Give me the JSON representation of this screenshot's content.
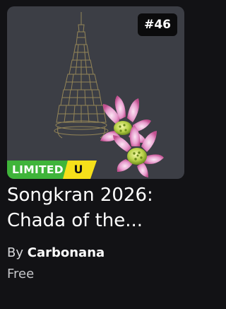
{
  "item": {
    "serial": "#46",
    "limited_label": "LIMITED",
    "limited_type": "U",
    "title": "Songkran 2026: Chada of the...",
    "creator_prefix": "By",
    "creator_name": "Carbonana",
    "price": "Free",
    "thumbnail_icon": "chada-crown-with-lotus-flowers-icon"
  },
  "colors": {
    "background": "#121215",
    "thumbnail_bg": "#3c3e45",
    "limited_green": "#3fb43a",
    "limited_yellow": "#f6e01a"
  }
}
